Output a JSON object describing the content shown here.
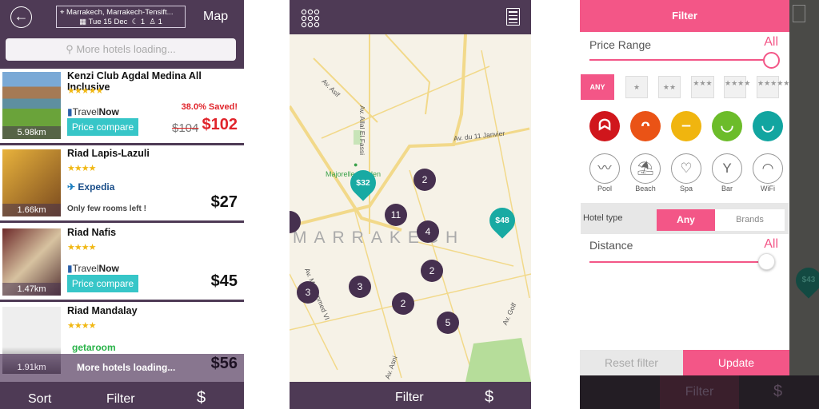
{
  "list_screen": {
    "header": {
      "back_icon": "arrow-left-icon",
      "location": "Marrakech, Marrakech-Tensift...",
      "date": "Tue 15 Dec",
      "rooms": "1",
      "guests": "1",
      "map_label": "Map"
    },
    "search_placeholder": "More hotels loading...",
    "hotels": [
      {
        "name": "Kenzi Club Agdal Medina All Inclusive",
        "stars": "★★★★★",
        "distance": "5.98km",
        "provider_a": "Travel",
        "provider_b": "Now",
        "button": "Price compare",
        "saved": "38.0% Saved!",
        "old_price": "$104",
        "price": "$102"
      },
      {
        "name": "Riad Lapis-Lazuli",
        "stars": "★★★★",
        "distance": "1.66km",
        "provider_a": "Expedia",
        "note": "Only few rooms left !",
        "price": "$27"
      },
      {
        "name": "Riad Nafis",
        "stars": "★★★★",
        "distance": "1.47km",
        "provider_a": "Travel",
        "provider_b": "Now",
        "button": "Price compare",
        "price": "$45"
      },
      {
        "name": "Riad Mandalay",
        "stars": "★★★★",
        "distance": "1.91km",
        "provider_a": "getaroom",
        "price": "$56"
      }
    ],
    "loading_text": "More hotels loading...",
    "bottom": {
      "sort": "Sort",
      "filter": "Filter",
      "currency": "$"
    }
  },
  "map_screen": {
    "city": "MARRAKECH",
    "streets": [
      "Av. Asif",
      "Av. Allal El Fassi",
      "Av. du 11 Janvier",
      "Av. Mohammed VI",
      "Av. Golf",
      "Av. Asni"
    ],
    "poi": "Majorelle Garden",
    "price_pins": [
      "$32",
      "$48"
    ],
    "clusters": [
      "2",
      "11",
      "4",
      "2",
      "3",
      "3",
      "2",
      "5"
    ],
    "bottom": {
      "filter": "Filter",
      "currency": "$"
    },
    "colors": {
      "pin": "#18aaa3",
      "cluster": "#46304f"
    }
  },
  "filter_screen": {
    "title": "Filter",
    "price_range": {
      "label": "Price Range",
      "value": "All",
      "level": 1.0
    },
    "star_options": [
      "ANY",
      "★",
      "★★",
      "★★★",
      "★★★★",
      "★★★★★"
    ],
    "mood_icons": [
      "crying-face-icon",
      "angry-face-icon",
      "neutral-face-icon",
      "smile-face-icon",
      "grin-face-icon"
    ],
    "amenities": [
      "Pool",
      "Beach",
      "Spa",
      "Bar",
      "WiFi"
    ],
    "hotel_type": {
      "label": "Hotel type",
      "options": [
        "Any",
        "Brands"
      ],
      "selected": "Any"
    },
    "distance": {
      "label": "Distance",
      "value": "All",
      "level": 1.0
    },
    "reset": "Reset filter",
    "update": "Update",
    "background_pin": "$43",
    "bottom": {
      "filter": "Filter",
      "currency": "$"
    },
    "accent": "#f35687"
  }
}
